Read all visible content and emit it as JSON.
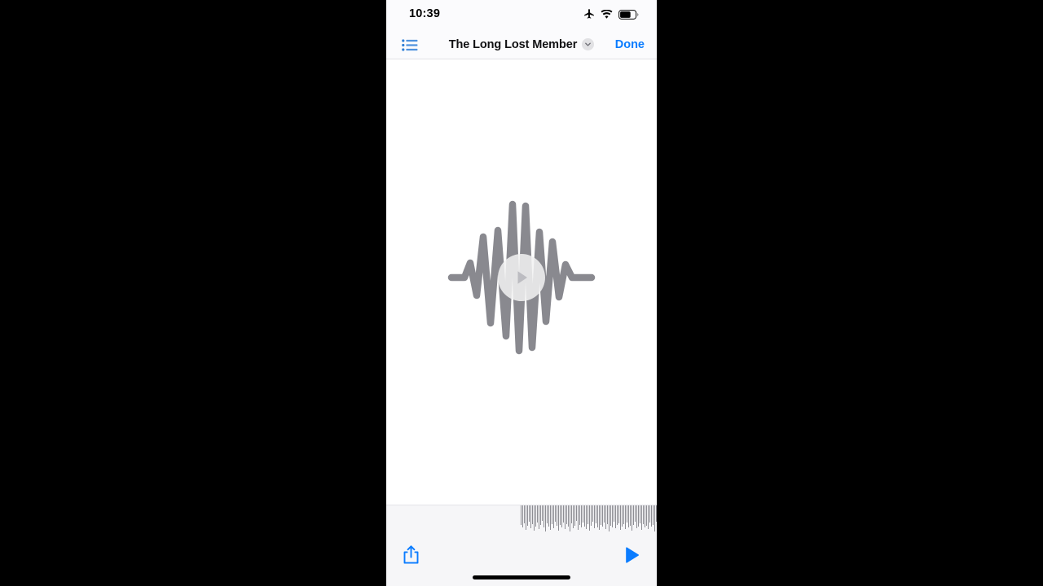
{
  "device": {
    "screen_background": "#ffffff",
    "outer_background": "#000000"
  },
  "status_bar": {
    "time": "10:39",
    "icons": [
      {
        "name": "airplane-mode-icon",
        "label": "Airplane Mode"
      },
      {
        "name": "wifi-icon",
        "label": "Wi-Fi"
      },
      {
        "name": "battery-icon",
        "label": "Battery",
        "fill_percent": 62
      }
    ],
    "background": "#fbfbfd",
    "text_color": "#000000"
  },
  "nav_bar": {
    "list_icon": "list-bullet-icon",
    "title": "The Long Lost Member",
    "chevron_icon": "chevron-down-icon",
    "done_label": "Done",
    "accent_color": "#0a7cff",
    "title_color": "#111113"
  },
  "content": {
    "illustration_name": "audio-waveform-illustration",
    "illustration_color": "#89898f",
    "play_overlay": {
      "name": "play-overlay-button",
      "label": "Play",
      "circle_color": "#f2f2f2",
      "triangle_color": "#b8b8bd"
    }
  },
  "bottom_toolbar": {
    "background": "#f6f6f8",
    "share_label": "Share",
    "share_icon": "share-icon",
    "play_label": "Play",
    "play_icon": "play-triangle-icon",
    "accent_color": "#0a7cff",
    "scrubber": {
      "name": "audio-scrubber-waveform",
      "bar_color": "#8d8d93",
      "bar_heights": [
        24,
        27,
        22,
        30,
        25,
        20,
        28,
        23,
        31,
        26,
        21,
        29,
        24,
        19,
        27,
        32,
        22,
        26,
        30,
        23,
        28,
        20,
        25,
        31,
        24,
        27,
        21,
        29,
        23,
        26,
        32,
        22,
        28,
        25,
        19,
        30,
        24,
        27,
        21,
        26,
        29,
        23,
        31,
        25,
        20,
        28,
        22,
        27,
        30,
        24,
        26,
        21,
        29,
        23,
        32,
        25,
        27,
        20,
        28,
        24,
        22,
        30,
        26,
        23,
        29,
        21,
        27,
        25,
        31,
        24,
        20,
        28,
        26,
        22,
        30,
        23,
        27,
        25,
        29,
        21,
        26,
        24,
        32,
        20,
        28,
        23,
        27,
        30,
        22,
        25
      ]
    }
  },
  "home_indicator": {
    "name": "home-indicator",
    "color": "#000000"
  }
}
